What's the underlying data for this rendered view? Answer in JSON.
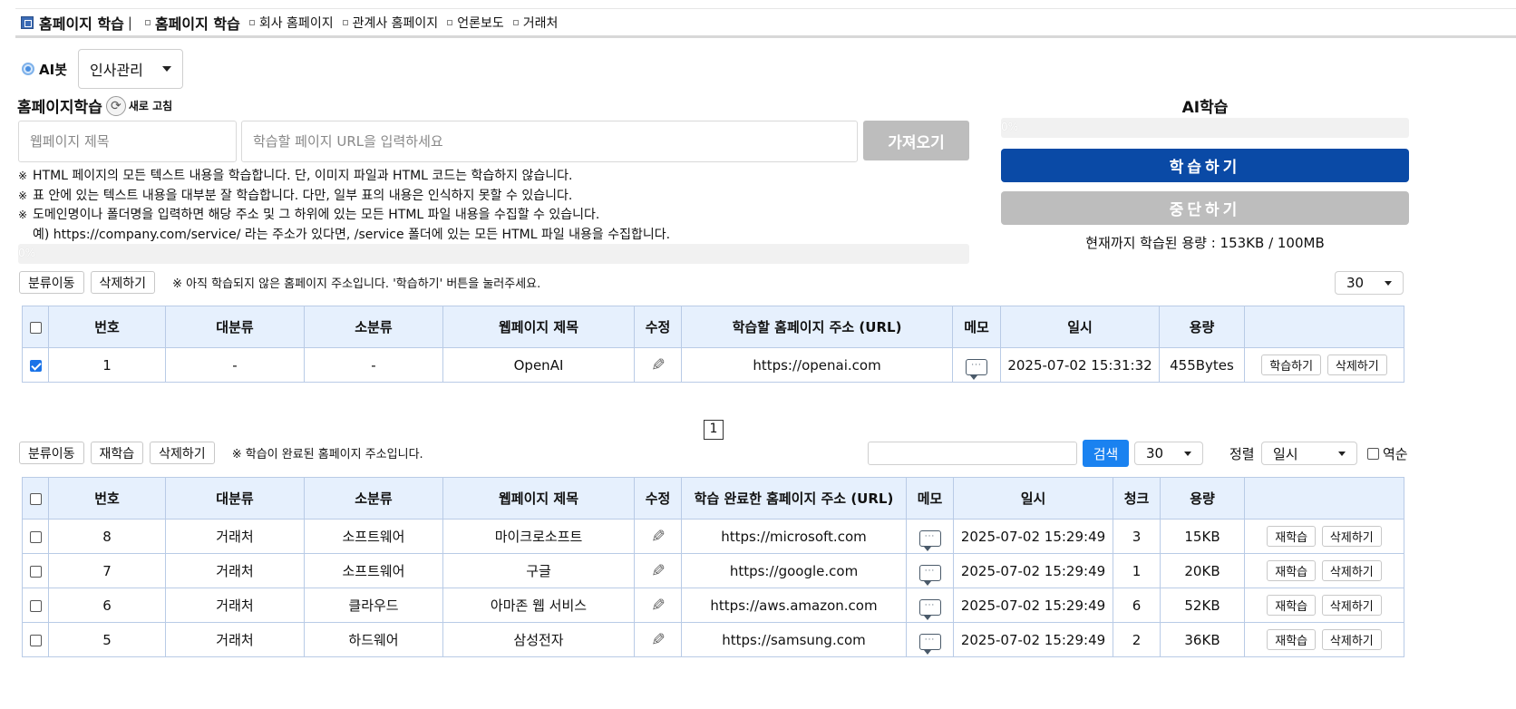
{
  "topbar": {
    "title": "홈페이지 학습",
    "separator": "|",
    "crumbs": [
      "홈페이지 학습",
      "회사 홈페이지",
      "관계사 홈페이지",
      "언론보도",
      "거래처"
    ]
  },
  "bot": {
    "label": "AI봇",
    "selected": "인사관리"
  },
  "learn": {
    "title": "홈페이지학습",
    "refresh_label": "새로 고침",
    "title_placeholder": "웹페이지 제목",
    "url_placeholder": "학습할 페이지 URL을 입력하세요",
    "fetch_label": "가져오기",
    "notes": [
      "HTML 페이지의 모든 텍스트 내용을 학습합니다. 단, 이미지 파일과 HTML 코드는 학습하지 않습니다.",
      "표 안에 있는 텍스트 내용을 대부분 잘 학습합니다. 다만, 일부 표의 내용은 인식하지 못할 수 있습니다.",
      "도메인명이나 폴더명을 입력하면 해당 주소 및 그 하위에 있는 모든 HTML 파일 내용을 수집할 수 있습니다."
    ],
    "note_example": "예) https://company.com/service/ 라는 주소가 있다면, /service 폴더에 있는 모든 HTML 파일 내용을 수집합니다.",
    "note_mark": "※",
    "progress_text": "0%",
    "progress_value": 0
  },
  "ai": {
    "title": "AI학습",
    "progress_text": "0%",
    "progress_value": 0,
    "learn_label": "학습하기",
    "stop_label": "중단하기",
    "usage": "현재까지 학습된 용량 : 153KB / 100MB"
  },
  "pending": {
    "move_label": "분류이동",
    "delete_label": "삭제하기",
    "hint": "※ 아직 학습되지 않은 홈페이지 주소입니다. '학습하기' 버튼을 눌러주세요.",
    "page_size": "30",
    "columns": [
      "번호",
      "대분류",
      "소분류",
      "웹페이지 제목",
      "수정",
      "학습할 홈페이지 주소 (URL)",
      "메모",
      "일시",
      "용량"
    ],
    "rows": [
      {
        "no": "1",
        "major": "-",
        "minor": "-",
        "title": "OpenAI",
        "url": "https://openai.com",
        "date": "2025-07-02 15:31:32",
        "size": "455Bytes",
        "checked": true
      }
    ],
    "row_learn": "학습하기",
    "row_delete": "삭제하기"
  },
  "pager": {
    "page": "1"
  },
  "done": {
    "move_label": "분류이동",
    "relearn_label": "재학습",
    "delete_label": "삭제하기",
    "hint": "※ 학습이 완료된 홈페이지 주소입니다.",
    "search_label": "검색",
    "page_size": "30",
    "sort_label": "정렬",
    "sort_value": "일시",
    "reverse_label": "역순",
    "columns": [
      "번호",
      "대분류",
      "소분류",
      "웹페이지 제목",
      "수정",
      "학습 완료한 홈페이지 주소 (URL)",
      "메모",
      "일시",
      "청크",
      "용량"
    ],
    "rows": [
      {
        "no": "8",
        "major": "거래처",
        "minor": "소프트웨어",
        "title": "마이크로소프트",
        "url": "https://microsoft.com",
        "date": "2025-07-02 15:29:49",
        "chunk": "3",
        "size": "15KB"
      },
      {
        "no": "7",
        "major": "거래처",
        "minor": "소프트웨어",
        "title": "구글",
        "url": "https://google.com",
        "date": "2025-07-02 15:29:49",
        "chunk": "1",
        "size": "20KB"
      },
      {
        "no": "6",
        "major": "거래처",
        "minor": "클라우드",
        "title": "아마존 웹 서비스",
        "url": "https://aws.amazon.com",
        "date": "2025-07-02 15:29:49",
        "chunk": "6",
        "size": "52KB"
      },
      {
        "no": "5",
        "major": "거래처",
        "minor": "하드웨어",
        "title": "삼성전자",
        "url": "https://samsung.com",
        "date": "2025-07-02 15:29:49",
        "chunk": "2",
        "size": "36KB"
      }
    ],
    "row_relearn": "재학습",
    "row_delete": "삭제하기"
  }
}
